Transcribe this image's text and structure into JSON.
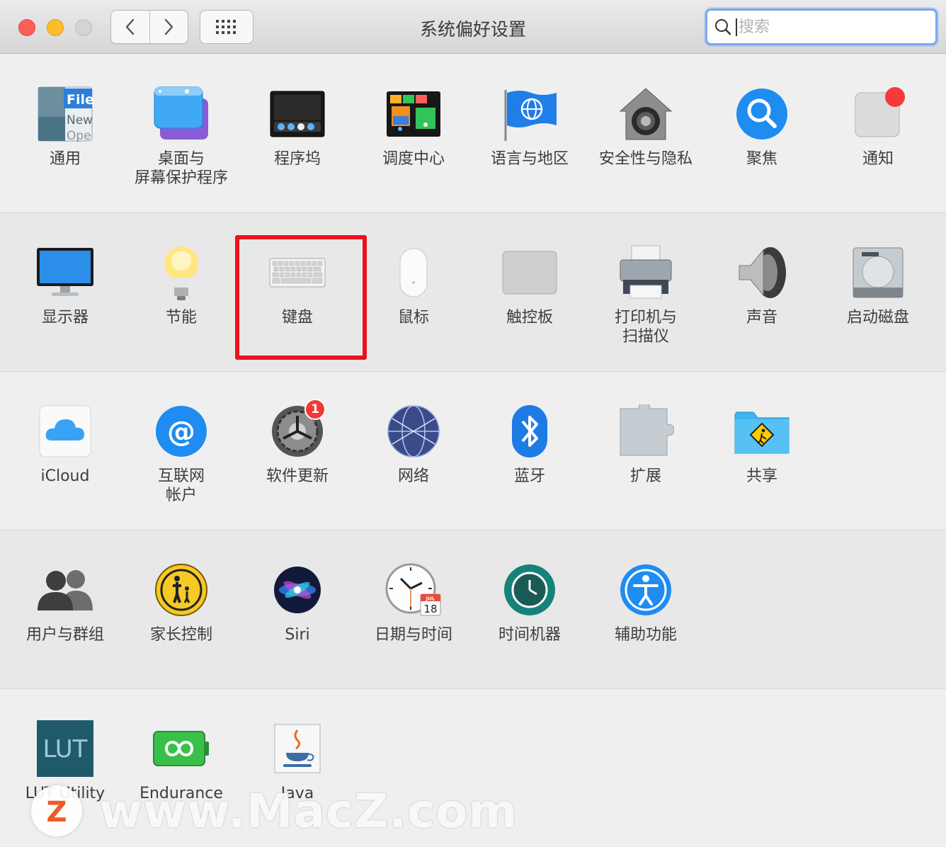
{
  "window": {
    "title": "系统偏好设置",
    "search_placeholder": "搜索"
  },
  "rows": [
    {
      "items": [
        {
          "label": "通用",
          "icon": "general-icon"
        },
        {
          "label": "桌面与\n屏幕保护程序",
          "icon": "desktop-screensaver-icon"
        },
        {
          "label": "程序坞",
          "icon": "dock-icon"
        },
        {
          "label": "调度中心",
          "icon": "mission-control-icon"
        },
        {
          "label": "语言与地区",
          "icon": "language-region-icon"
        },
        {
          "label": "安全性与隐私",
          "icon": "security-privacy-icon"
        },
        {
          "label": "聚焦",
          "icon": "spotlight-icon"
        },
        {
          "label": "通知",
          "icon": "notifications-icon"
        }
      ]
    },
    {
      "items": [
        {
          "label": "显示器",
          "icon": "displays-icon"
        },
        {
          "label": "节能",
          "icon": "energy-saver-icon"
        },
        {
          "label": "键盘",
          "icon": "keyboard-icon"
        },
        {
          "label": "鼠标",
          "icon": "mouse-icon"
        },
        {
          "label": "触控板",
          "icon": "trackpad-icon"
        },
        {
          "label": "打印机与\n扫描仪",
          "icon": "printers-scanners-icon"
        },
        {
          "label": "声音",
          "icon": "sound-icon"
        },
        {
          "label": "启动磁盘",
          "icon": "startup-disk-icon"
        }
      ]
    },
    {
      "items": [
        {
          "label": "iCloud",
          "icon": "icloud-icon"
        },
        {
          "label": "互联网\n帐户",
          "icon": "internet-accounts-icon"
        },
        {
          "label": "软件更新",
          "icon": "software-update-icon",
          "badge": "1"
        },
        {
          "label": "网络",
          "icon": "network-icon"
        },
        {
          "label": "蓝牙",
          "icon": "bluetooth-icon"
        },
        {
          "label": "扩展",
          "icon": "extensions-icon"
        },
        {
          "label": "共享",
          "icon": "sharing-icon"
        }
      ]
    },
    {
      "items": [
        {
          "label": "用户与群组",
          "icon": "users-groups-icon"
        },
        {
          "label": "家长控制",
          "icon": "parental-controls-icon"
        },
        {
          "label": "Siri",
          "icon": "siri-icon"
        },
        {
          "label": "日期与时间",
          "icon": "date-time-icon",
          "calendar_month": "JUL",
          "calendar_day": "18"
        },
        {
          "label": "时间机器",
          "icon": "time-machine-icon"
        },
        {
          "label": "辅助功能",
          "icon": "accessibility-icon"
        }
      ]
    },
    {
      "items": [
        {
          "label": "LUT Utility",
          "icon": "lut-utility-icon",
          "icon_text": "LUT"
        },
        {
          "label": "Endurance",
          "icon": "endurance-icon"
        },
        {
          "label": "Java",
          "icon": "java-icon"
        }
      ]
    }
  ],
  "watermark": {
    "text": "www.MacZ.com",
    "logo_letter": "Z"
  },
  "colors": {
    "highlight": "#e8131d",
    "search_focus": "#7aa9ee",
    "badge": "#f23a36"
  }
}
